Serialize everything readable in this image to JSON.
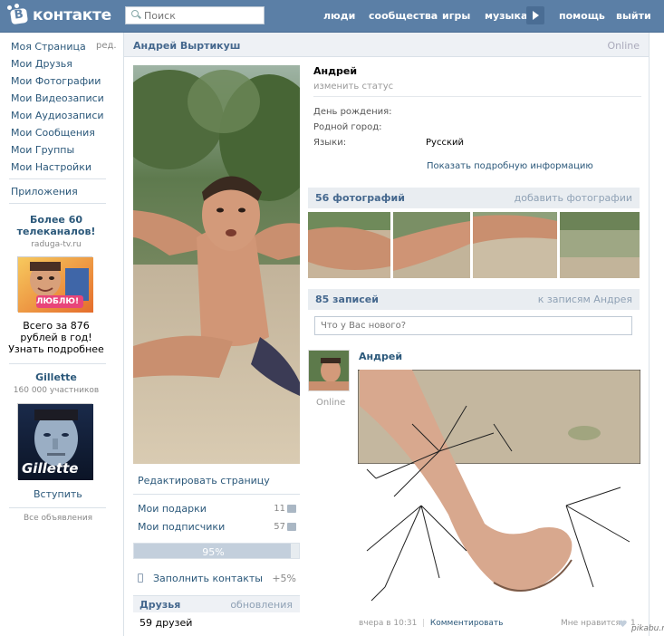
{
  "header": {
    "logo_text": "контакте",
    "search_placeholder": "Поиск",
    "nav": [
      "люди",
      "сообщества",
      "игры",
      "музыка",
      "помощь",
      "выйти"
    ]
  },
  "left_menu": {
    "items": [
      "Моя Страница",
      "Мои Друзья",
      "Мои Фотографии",
      "Мои Видеозаписи",
      "Мои Аудиозаписи",
      "Мои Сообщения",
      "Мои Группы",
      "Мои Настройки"
    ],
    "edit_label": "ред.",
    "apps_label": "Приложения"
  },
  "ads": {
    "ad1": {
      "title": "Более 60 телеканалов!",
      "domain": "raduga-tv.ru",
      "image_text": "ЛЮБЛЮ!",
      "text": "Всего за 876 рублей в год! Узнать подробнее"
    },
    "ad2": {
      "title": "Gillette",
      "members": "160 000 участников",
      "image_text": "Gillette",
      "join_label": "Вступить"
    },
    "all_ads": "Все объявления"
  },
  "profile": {
    "full_name": "Андрей Выртикуш",
    "online_label": "Online",
    "first_name": "Андрей",
    "status_placeholder": "изменить статус",
    "fields": {
      "birthday_label": "День рождения:",
      "hometown_label": "Родной город:",
      "languages_label": "Языки:",
      "languages_value": "Русский"
    },
    "more_info": "Показать подробную информацию",
    "edit_page": "Редактировать страницу",
    "gifts_label": "Мои подарки",
    "gifts_count": "11",
    "followers_label": "Мои подписчики",
    "followers_count": "57",
    "completeness": "95%",
    "completeness_value": 0.95,
    "fill_contacts": "Заполнить контакты",
    "fill_bonus": "+5%",
    "friends_title": "Друзья",
    "friends_updates": "обновления",
    "friends_count": "59 друзей"
  },
  "photos": {
    "title": "56 фотографий",
    "add_label": "добавить фотографии"
  },
  "wall": {
    "title": "85 записей",
    "link": "к записям Андрея",
    "input_placeholder": "Что у Вас нового?",
    "post_author": "Андрей",
    "post_online": "Online",
    "post_time": "вчера в 10:31",
    "post_comment": "Комментировать",
    "post_like": "Мне нравится",
    "post_like_count": "1"
  },
  "watermark": "pikabu.ru",
  "colors": {
    "header_bg": "#5b7fa6",
    "link": "#2b587a",
    "section_bg": "#e9edf1"
  }
}
